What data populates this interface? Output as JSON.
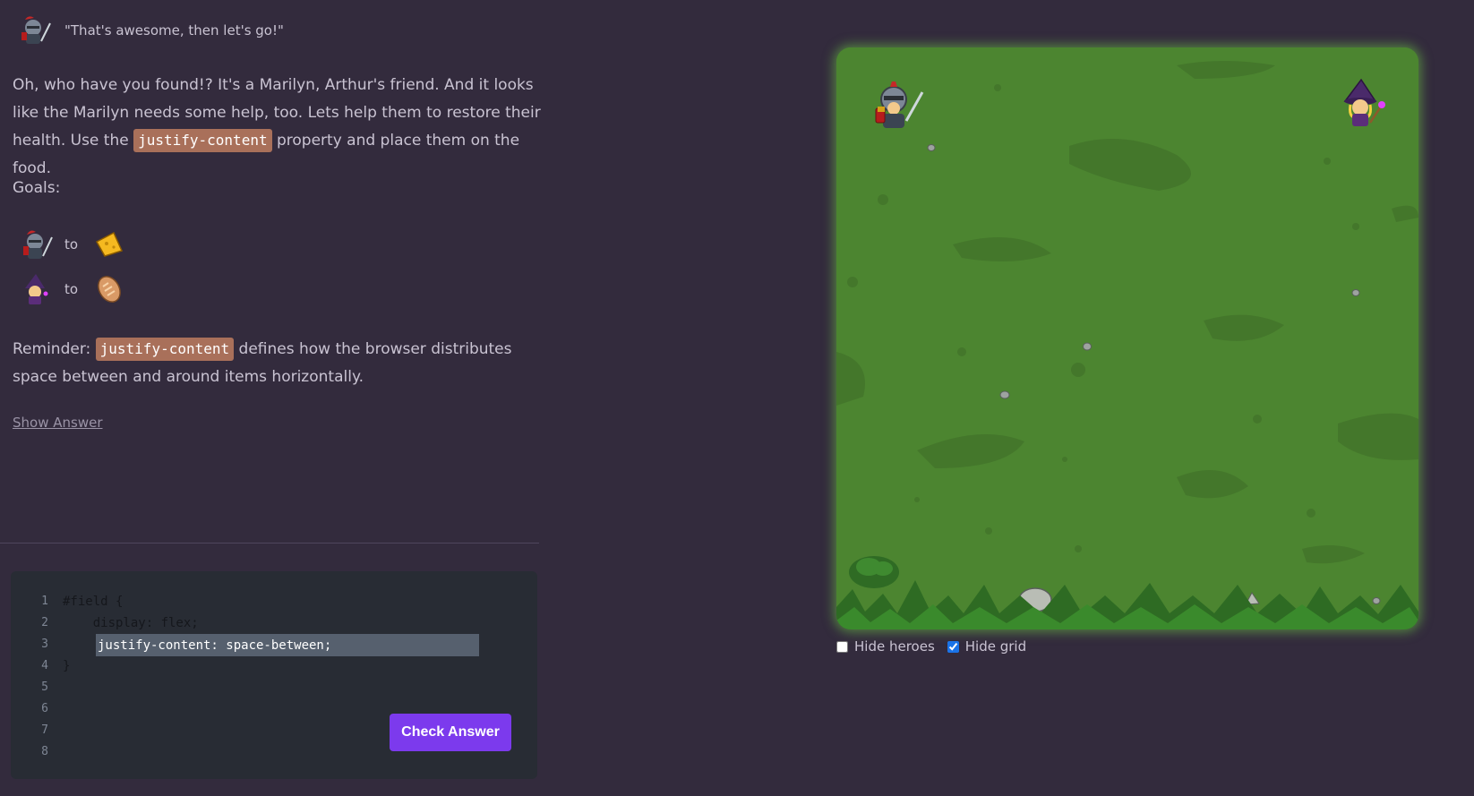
{
  "dialog": {
    "quote": "\"That's awesome, then let's go!\""
  },
  "story": {
    "part1": "Oh, who have you found!? It's a Marilyn, Arthur's friend. And it looks like the Marilyn needs some help, too. Lets help them to restore their health. Use the ",
    "chip": "justify-content",
    "part2": " property and place them on the food."
  },
  "goals": {
    "label": "Goals:",
    "items": [
      {
        "hero_icon": "knight-icon",
        "to": "to",
        "food_icon": "cheese-icon"
      },
      {
        "hero_icon": "witch-icon",
        "to": "to",
        "food_icon": "bread-icon"
      }
    ]
  },
  "reminder": {
    "prefix": "Reminder: ",
    "chip": "justify-content",
    "suffix": " defines how the browser distributes space between and around items horizontally."
  },
  "show_answer": "Show Answer",
  "editor": {
    "line_numbers": [
      "1",
      "2",
      "3",
      "4",
      "5",
      "6",
      "7",
      "8"
    ],
    "line1": "#field {",
    "line2": "    display: flex;",
    "input_value": "justify-content: space-between;",
    "line4": "}",
    "check_label": "Check Answer"
  },
  "options": {
    "hide_heroes_label": "Hide heroes",
    "hide_heroes_checked": false,
    "hide_grid_label": "Hide grid",
    "hide_grid_checked": true
  },
  "colors": {
    "background": "#332b3d",
    "chip": "#a9705a",
    "button": "#7c3aed",
    "field_grass": "#4c8530"
  }
}
